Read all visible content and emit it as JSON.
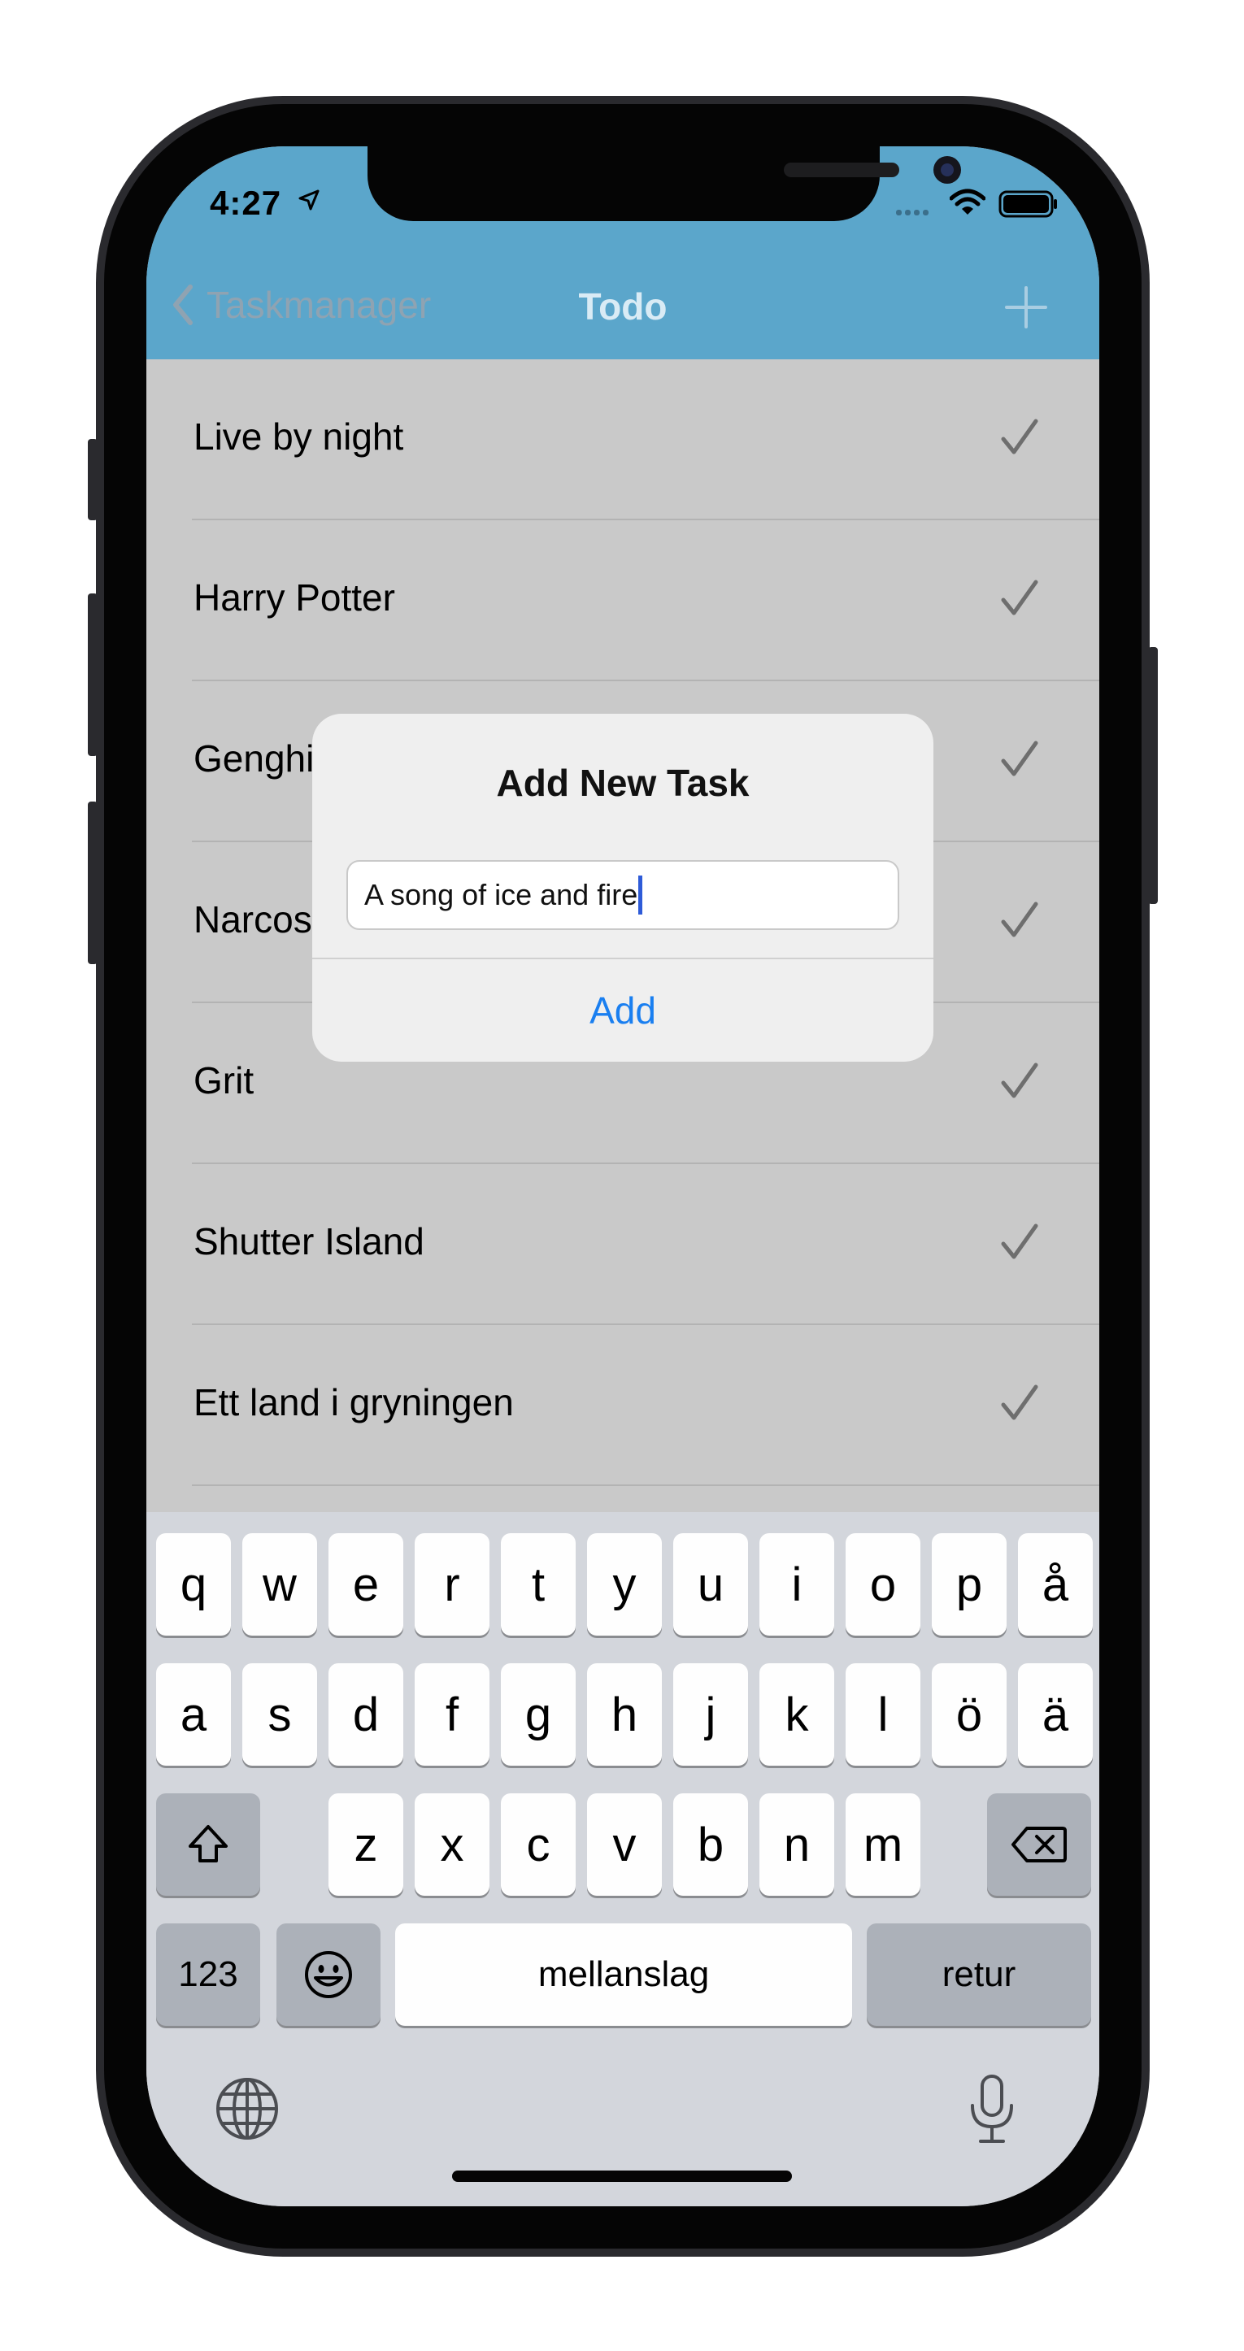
{
  "status_bar": {
    "time": "4:27"
  },
  "nav": {
    "back_label": "Taskmanager",
    "title": "Todo"
  },
  "tasks": [
    {
      "label": "Live by night"
    },
    {
      "label": "Harry Potter"
    },
    {
      "label": "Genghis Khan"
    },
    {
      "label": "Narcos"
    },
    {
      "label": "Grit"
    },
    {
      "label": "Shutter Island"
    },
    {
      "label": "Ett land i gryningen"
    }
  ],
  "alert": {
    "title": "Add New Task",
    "input_value": "A song of ice and fire",
    "add_label": "Add"
  },
  "keyboard": {
    "row1": [
      "q",
      "w",
      "e",
      "r",
      "t",
      "y",
      "u",
      "i",
      "o",
      "p",
      "å"
    ],
    "row2": [
      "a",
      "s",
      "d",
      "f",
      "g",
      "h",
      "j",
      "k",
      "l",
      "ö",
      "ä"
    ],
    "row3": [
      "z",
      "x",
      "c",
      "v",
      "b",
      "n",
      "m"
    ],
    "numbers_label": "123",
    "space_label": "mellanslag",
    "return_label": "retur"
  },
  "colors": {
    "nav_bar": "#5ba6cb",
    "accent": "#1a7ff0",
    "dimmed_background": "#c9c9c9"
  }
}
